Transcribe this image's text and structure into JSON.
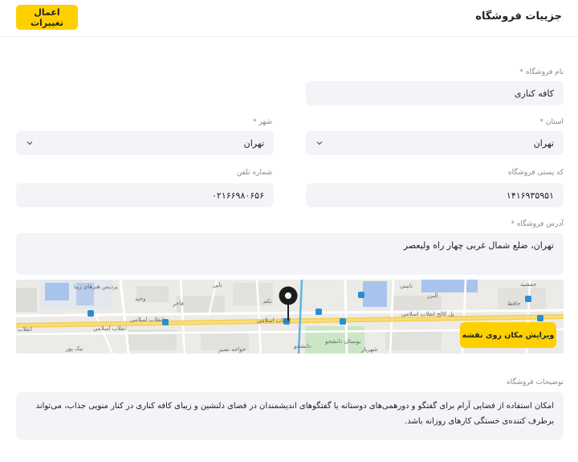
{
  "header": {
    "title": "جزییات فروشگاه",
    "apply_label": "اعمال تغییرات"
  },
  "form": {
    "shop_name": {
      "label": "نام فروشگاه *",
      "value": "کافه کناری"
    },
    "province": {
      "label": "استان *",
      "value": "تهران"
    },
    "city": {
      "label": "شهر *",
      "value": "تهران"
    },
    "postal_code": {
      "label": "کد پستی فروشگاه",
      "value": "۱۴۱۶۹۳۵۹۵۱"
    },
    "phone": {
      "label": "شماره تلفن",
      "value": "۰۲۱۶۶۹۸۰۶۵۶"
    },
    "address": {
      "label": "آدرس فروشگاه *",
      "value": "تهران، ضلع شمال غربی چهار راه ولیعصر"
    },
    "description": {
      "label": "توضیحات فروشگاه",
      "value": "امکان استفاده از فضایی آرام برای گفتگو و دورهمی‌های دوستانه یا گفتگوهای اندیشمندان در فضای دلنشین و زیبای کافه کناری در کنار منویی جذاب، می‌تواند برطرف کننده‌ی خستگی کارهای روزانه باشد."
    }
  },
  "map": {
    "edit_label": "ویرایش مکان روی نقشه",
    "streets": {
      "enghelab_1": "انقلاب اسلامی",
      "enghelab_2": "انقلاب اسلامی",
      "enghelab_3": "انقلاب اسلامی",
      "enghelab_4": "انقلاب",
      "pol_kalej": "پل کالج انقلاب اسلامی",
      "pardis": "پردیس هنرهای زیبا",
      "daneshjoo_park": "بوستان دانشجو",
      "daneshjoo": "دانشجو",
      "nik_poor": "نیک پور",
      "khajeh_nasir": "خواجه نصیر",
      "shahriar": "شهریار",
      "jamshid": "جمشید",
      "nabi": "نابی",
      "nabini": "نابینی",
      "alborz": "البرز",
      "fakhr": "فاخر",
      "vahid": "وحید",
      "hafez": "حافظ",
      "nakam": "نکم"
    }
  },
  "icons": {
    "map_pin": "map-pin-icon",
    "chevron": "chevron-down-icon"
  },
  "colors": {
    "accent": "#ffd000",
    "field_bg": "#f3f4f7",
    "map_bg": "#ededea"
  }
}
